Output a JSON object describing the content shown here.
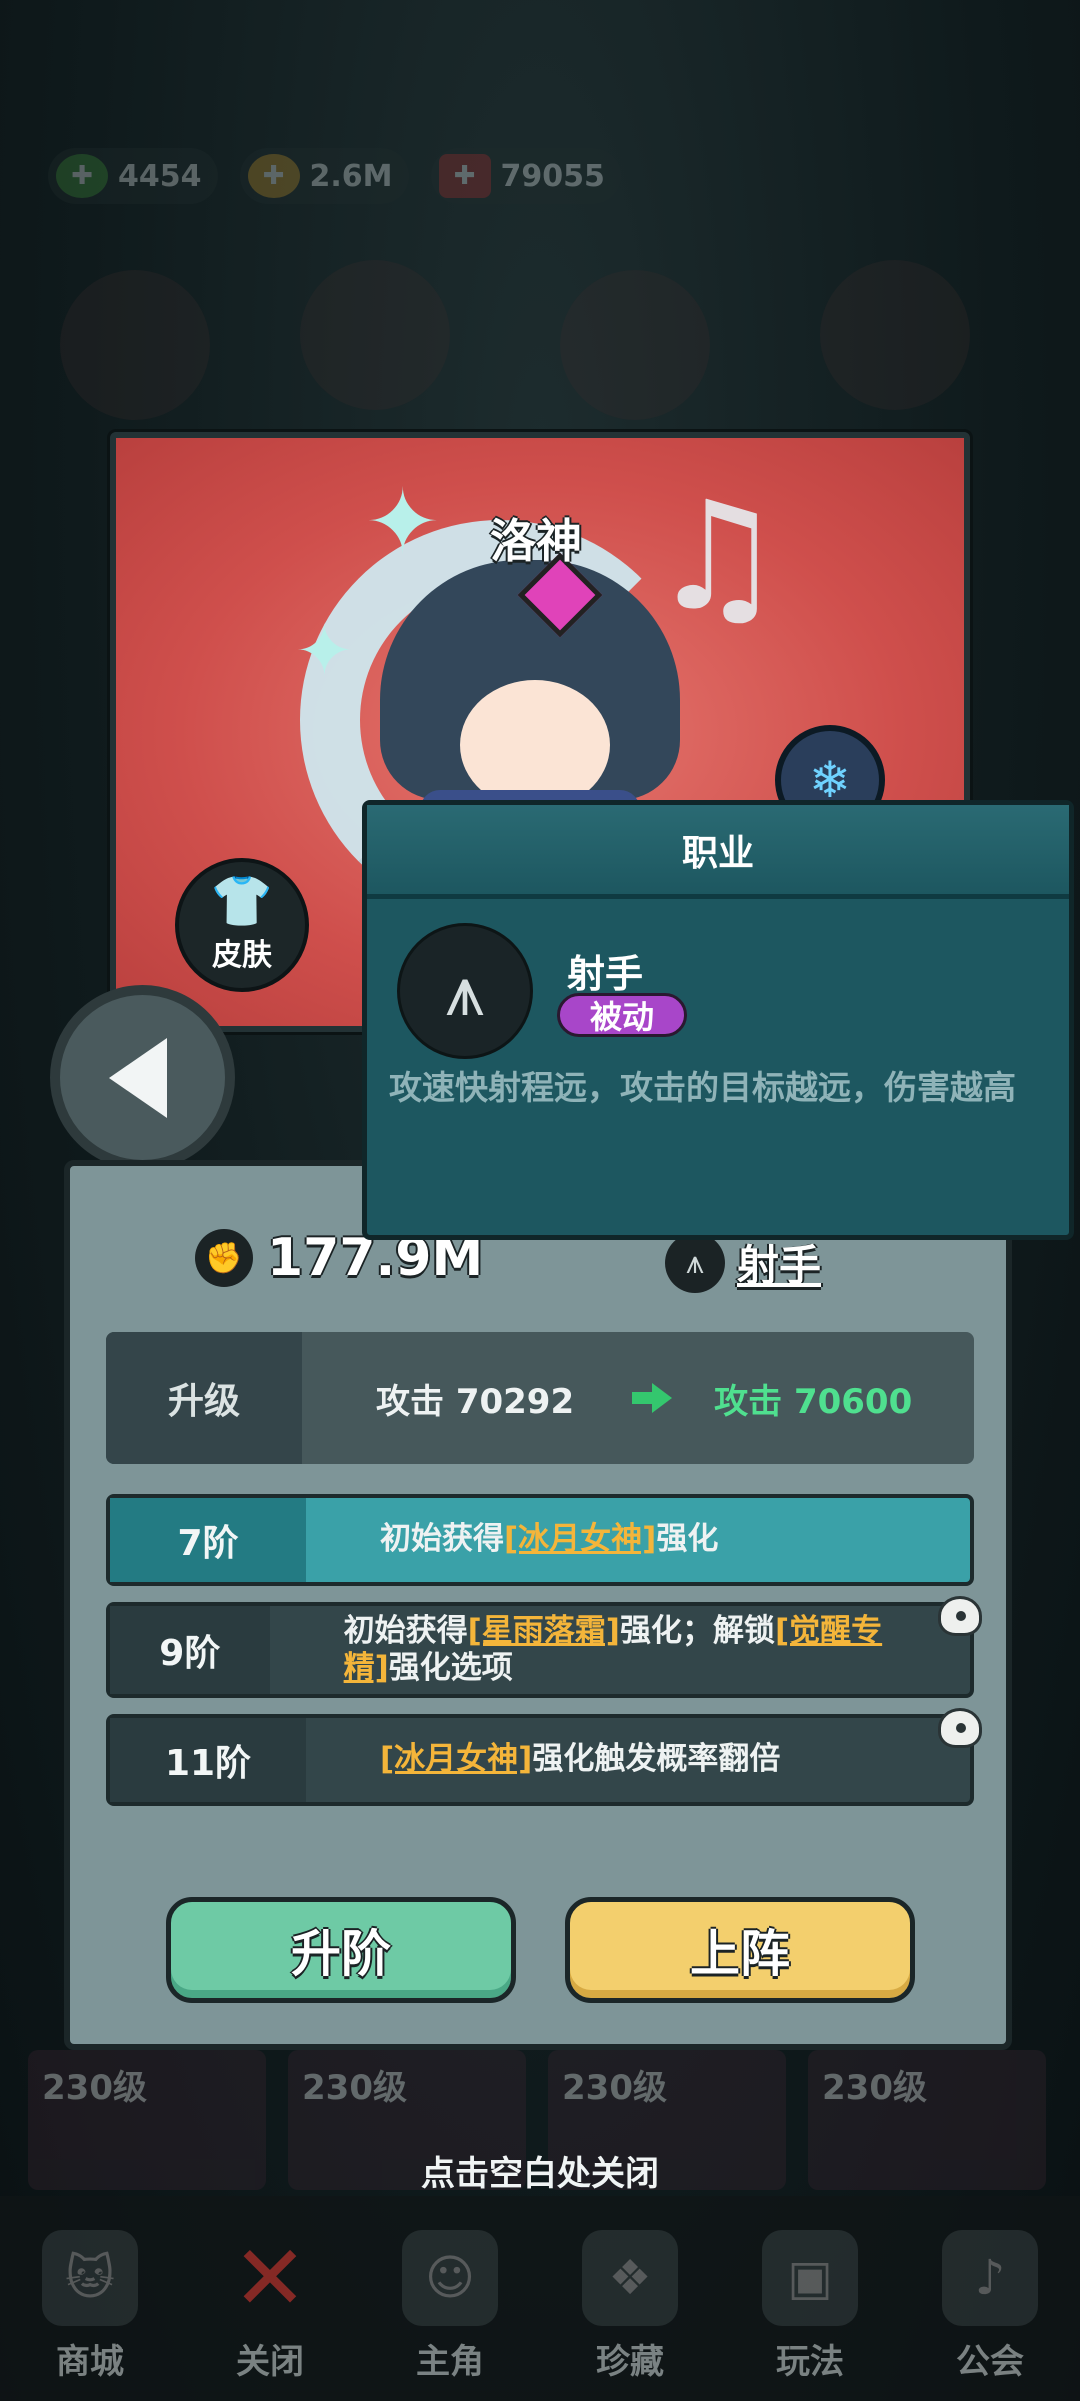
{
  "currency": [
    {
      "icon": "green-gem-icon",
      "value": "4454"
    },
    {
      "icon": "gold-coin-icon",
      "value": "2.6M"
    },
    {
      "icon": "red-book-icon",
      "value": "79055"
    }
  ],
  "hero": {
    "name": "洛神",
    "skin_label": "皮肤"
  },
  "stats": {
    "power": "177.9M",
    "class_name": "射手"
  },
  "upgrade": {
    "label": "升级",
    "from": "攻击 70292",
    "to": "攻击 70600"
  },
  "ranks": [
    {
      "rank": "7阶",
      "parts": [
        "初始获得",
        "[冰月女神]",
        "强化"
      ],
      "active": true,
      "locked": false
    },
    {
      "rank": "9阶",
      "parts": [
        "初始获得",
        "[星雨落霜]",
        "强化；解锁",
        "[觉醒专精]",
        "强化选项"
      ],
      "active": false,
      "locked": true
    },
    {
      "rank": "11阶",
      "parts": [
        "[冰月女神]",
        "强化触发概率翻倍"
      ],
      "active": false,
      "locked": true
    }
  ],
  "buttons": {
    "upgrade_rank": "升阶",
    "deploy": "上阵"
  },
  "close_hint": "点击空白处关闭",
  "tooltip": {
    "header": "职业",
    "title": "射手",
    "badge": "被动",
    "description": "攻速快射程远，攻击的目标越远，伤害越高"
  },
  "bottom_tiles": [
    "230级",
    "230级",
    "230级",
    "230级"
  ],
  "nav": [
    {
      "label": "商城",
      "icon": "cat-icon"
    },
    {
      "label": "关闭",
      "icon": "close-icon"
    },
    {
      "label": "主角",
      "icon": "character-icon"
    },
    {
      "label": "珍藏",
      "icon": "treasure-icon"
    },
    {
      "label": "玩法",
      "icon": "tv-icon"
    },
    {
      "label": "公会",
      "icon": "horn-icon"
    }
  ],
  "colors": {
    "accent_teal": "#3aa1a8",
    "highlight_gold": "#f4b53a",
    "stat_green": "#4fe08f",
    "badge_purple": "#a846c9"
  }
}
